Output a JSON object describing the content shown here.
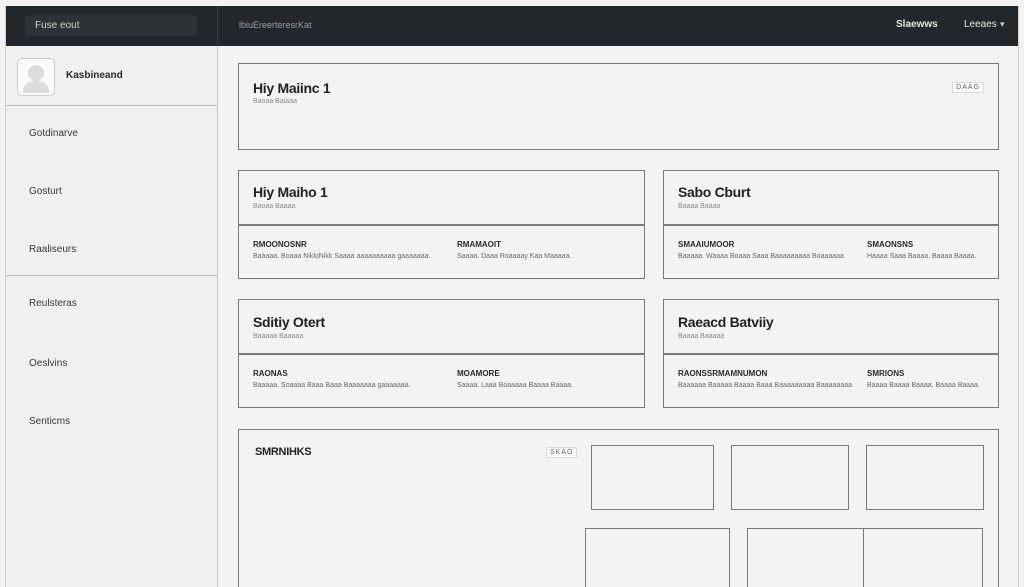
{
  "topbar": {
    "search_placeholder": "Fuse eout",
    "breadcrumb": "lbiuEreerteresrKat",
    "link": "Slaewws",
    "user": "Leeaes",
    "caret": "▾"
  },
  "sidebar": {
    "brand": "Kasbineand",
    "items": [
      "Gotdinarve",
      "Gosturt",
      "Raaliseurs",
      "Reulsteras",
      "Oeslvins",
      "Senticms"
    ]
  },
  "main": {
    "hero": {
      "title": "Hiy Maiinc 1",
      "subtitle": "Baoaa Baiaaa",
      "tag": "DAAG"
    },
    "cards": [
      {
        "title": "Hiy Maiho 1",
        "subtitle": "Baoaa Baaaa",
        "col1": {
          "head": "RMOONOSNR",
          "text": "Baaaaa. Boaaa NikloNikk Saaaa aaaaaaaaaa gaaaaaaa."
        },
        "col2": {
          "head": "RMAMAOIT",
          "text": "Saaaa. Daaa Roaaaay Kaa Maaaaa."
        }
      },
      {
        "title": "Sabo Cburt",
        "subtitle": "Baaaa Baaaa",
        "col1": {
          "head": "SMAAIUMOOR",
          "text": "Baaaaa. Waaaa Boaaa Saaa Baaaaaaaaa Boaaaaaa"
        },
        "col2": {
          "head": "SMAONSNS",
          "text": "Haaaa Saaa Baaaa. Baaaa Baaaa."
        }
      },
      {
        "title": "Sditiy Otert",
        "subtitle": "Baaaaa Baaaaa",
        "col1": {
          "head": "RAONAS",
          "text": "Baaaaa. Soaaaa Baaa Baaa Baaaaaaa gaaaaaaa."
        },
        "col2": {
          "head": "MOAMORE",
          "text": "Saaaa. Laaa Boaaaaa Baaaa Baaaa."
        }
      },
      {
        "title": "Raeacd Batviiy",
        "subtitle": "Baaaa Baaaaa",
        "col1": {
          "head": "RAONSSRMAMNUMON",
          "text": "Baaaaaa Baaaaa Baaaa Baaa Baaaaaaaaa Baaaaaaaa"
        },
        "col2": {
          "head": "SMRIONS",
          "text": "Baaaa Baaaa Baaaa. Baaaa Baaaa."
        }
      }
    ],
    "gallery": {
      "title": "SMRNIHKS",
      "tag": "SKAO"
    }
  }
}
